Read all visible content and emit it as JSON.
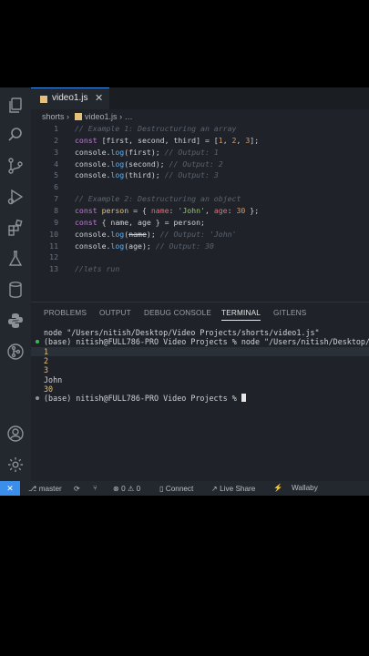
{
  "colors": {
    "accent": "#3b8eea",
    "editor_bg": "#1f2329"
  },
  "activity_bar": {
    "icons": [
      "explorer-icon",
      "search-icon",
      "source-control-icon",
      "run-debug-icon",
      "extensions-icon",
      "testing-icon",
      "database-icon",
      "python-icon",
      "git-graph-icon",
      "account-icon",
      "settings-icon"
    ]
  },
  "tab": {
    "label": "video1.js",
    "close": "✕"
  },
  "breadcrumb": {
    "folder": "shorts",
    "sep1": "›",
    "file": "video1.js",
    "sep2": "›",
    "more": "…"
  },
  "editor": {
    "lines": [
      {
        "n": "1",
        "tokens": [
          {
            "t": "// Example 1: Destructuring an array",
            "c": "cm"
          }
        ]
      },
      {
        "n": "2",
        "tokens": [
          {
            "t": "const ",
            "c": "kw"
          },
          {
            "t": "[first, second, third] = [",
            "c": ""
          },
          {
            "t": "1",
            "c": "num"
          },
          {
            "t": ", ",
            "c": ""
          },
          {
            "t": "2",
            "c": "num"
          },
          {
            "t": ", ",
            "c": ""
          },
          {
            "t": "3",
            "c": "num"
          },
          {
            "t": "];",
            "c": ""
          }
        ]
      },
      {
        "n": "3",
        "tokens": [
          {
            "t": "console",
            "c": ""
          },
          {
            "t": ".",
            "c": ""
          },
          {
            "t": "log",
            "c": "fn"
          },
          {
            "t": "(first); ",
            "c": ""
          },
          {
            "t": "// Output: 1",
            "c": "cm"
          }
        ]
      },
      {
        "n": "4",
        "tokens": [
          {
            "t": "console",
            "c": ""
          },
          {
            "t": ".",
            "c": ""
          },
          {
            "t": "log",
            "c": "fn"
          },
          {
            "t": "(second); ",
            "c": ""
          },
          {
            "t": "// Output: 2",
            "c": "cm"
          }
        ]
      },
      {
        "n": "5",
        "tokens": [
          {
            "t": "console",
            "c": ""
          },
          {
            "t": ".",
            "c": ""
          },
          {
            "t": "log",
            "c": "fn"
          },
          {
            "t": "(third); ",
            "c": ""
          },
          {
            "t": "// Output: 3",
            "c": "cm"
          }
        ]
      },
      {
        "n": "6",
        "tokens": []
      },
      {
        "n": "7",
        "tokens": [
          {
            "t": "// Example 2: Destructuring an object",
            "c": "cm"
          }
        ]
      },
      {
        "n": "8",
        "tokens": [
          {
            "t": "const ",
            "c": "kw"
          },
          {
            "t": "person",
            "c": "var"
          },
          {
            "t": " = { ",
            "c": ""
          },
          {
            "t": "name",
            "c": "prop"
          },
          {
            "t": ": ",
            "c": ""
          },
          {
            "t": "'John'",
            "c": "str"
          },
          {
            "t": ", ",
            "c": ""
          },
          {
            "t": "age",
            "c": "prop"
          },
          {
            "t": ": ",
            "c": ""
          },
          {
            "t": "30",
            "c": "num"
          },
          {
            "t": " };",
            "c": ""
          }
        ]
      },
      {
        "n": "9",
        "tokens": [
          {
            "t": "const ",
            "c": "kw"
          },
          {
            "t": "{ name, age } = person;",
            "c": ""
          }
        ]
      },
      {
        "n": "10",
        "tokens": [
          {
            "t": "console",
            "c": ""
          },
          {
            "t": ".",
            "c": ""
          },
          {
            "t": "log",
            "c": "fn"
          },
          {
            "t": "(",
            "c": ""
          },
          {
            "t": "name",
            "c": "strike"
          },
          {
            "t": "); ",
            "c": ""
          },
          {
            "t": "// Output: 'John'",
            "c": "cm"
          }
        ]
      },
      {
        "n": "11",
        "tokens": [
          {
            "t": "console",
            "c": ""
          },
          {
            "t": ".",
            "c": ""
          },
          {
            "t": "log",
            "c": "fn"
          },
          {
            "t": "(age); ",
            "c": ""
          },
          {
            "t": "// Output: 30",
            "c": "cm"
          }
        ]
      },
      {
        "n": "12",
        "tokens": []
      },
      {
        "n": "13",
        "tokens": [
          {
            "t": "//lets run",
            "c": "cm"
          }
        ]
      }
    ]
  },
  "panel": {
    "tabs": [
      "PROBLEMS",
      "OUTPUT",
      "DEBUG CONSOLE",
      "TERMINAL",
      "GITLENS"
    ],
    "active": "TERMINAL"
  },
  "terminal": {
    "lines": [
      {
        "text": "node \"/Users/nitish/Desktop/Video Projects/shorts/video1.js\"",
        "cls": "",
        "dot": ""
      },
      {
        "text": "(base) nitish@FULL786-PRO Video Projects % node \"/Users/nitish/Desktop/Vi",
        "cls": "",
        "dot": "#3fb950"
      },
      {
        "text": "1",
        "cls": "out",
        "dot": "",
        "hl": true
      },
      {
        "text": "2",
        "cls": "out",
        "dot": ""
      },
      {
        "text": "3",
        "cls": "out",
        "dot": ""
      },
      {
        "text": "John",
        "cls": "",
        "dot": ""
      },
      {
        "text": "30",
        "cls": "out",
        "dot": ""
      },
      {
        "text": "(base) nitish@FULL786-PRO Video Projects % ",
        "cls": "",
        "dot": "#8b949e",
        "cursor": true
      }
    ]
  },
  "status": {
    "remote": "✕",
    "branch": "master",
    "errors": "0",
    "warnings": "0",
    "connect": "Connect",
    "live_share": "Live Share",
    "wallaby": "Wallaby"
  }
}
